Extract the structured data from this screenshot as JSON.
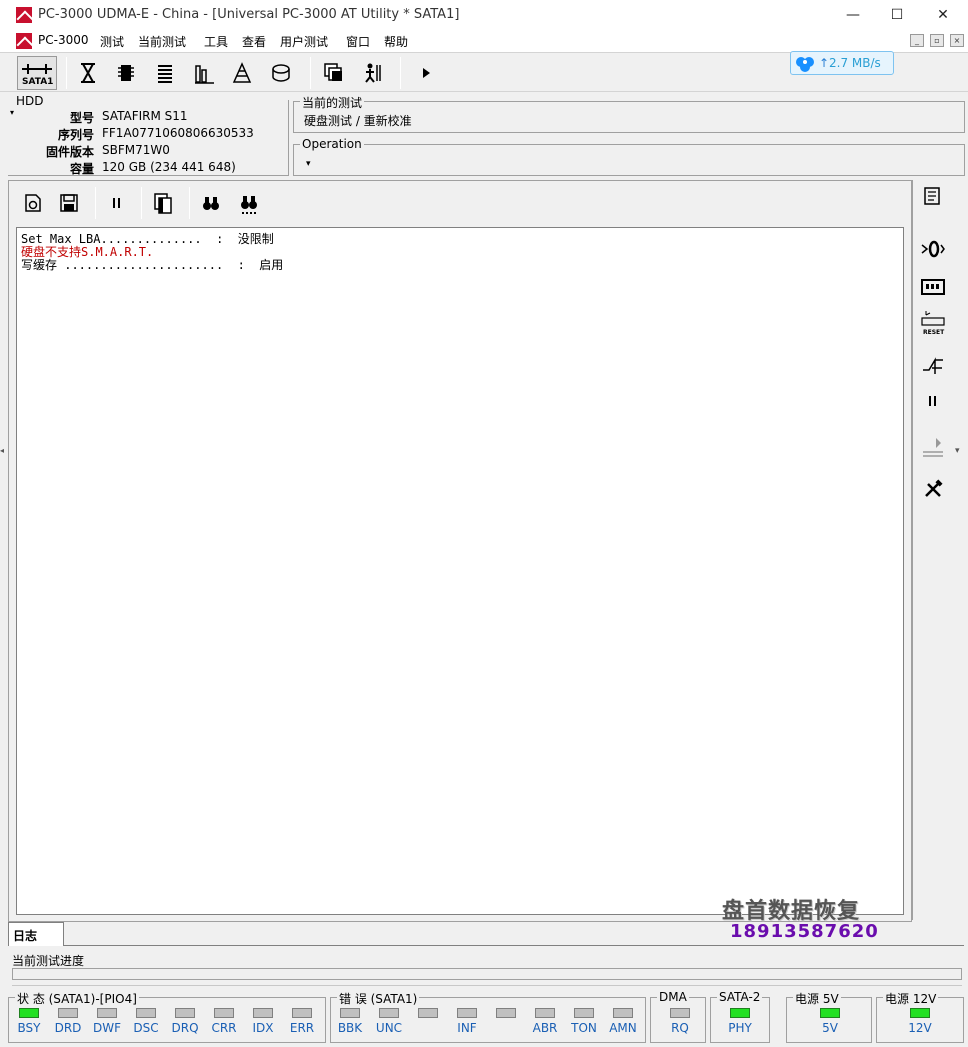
{
  "window": {
    "title": "PC-3000 UDMA-E - China - [Universal PC-3000 AT Utility * SATA1]",
    "minimize": "—",
    "maximize": "☐",
    "close": "✕"
  },
  "menu": {
    "items": [
      "PC-3000",
      "测试",
      "当前测试",
      "工具",
      "查看",
      "用户测试",
      "窗口",
      "帮助"
    ]
  },
  "toolbar": {
    "sata_label": "SATA1",
    "speed": "2.7 MB/s"
  },
  "hdd": {
    "legend": "HDD",
    "rows": [
      {
        "label": "型号",
        "value": "SATAFIRM   S11"
      },
      {
        "label": "序列号",
        "value": "FF1A0771060806630533"
      },
      {
        "label": "固件版本",
        "value": "SBFM71W0"
      },
      {
        "label": "容量",
        "value": "120 GB (234 441 648)"
      }
    ]
  },
  "current_test": {
    "legend": "当前的测试",
    "value": "硬盘测试 / 重新校准"
  },
  "operation": {
    "legend": "Operation",
    "dropdown": "▾"
  },
  "log": {
    "lines": [
      {
        "text": "Set Max LBA..............  :  没限制",
        "color": "#000000"
      },
      {
        "text": "硬盘不支持S.M.A.R.T.",
        "color": "#c00000"
      },
      {
        "text": "写缓存 ......................  :  启用",
        "color": "#000000"
      }
    ]
  },
  "tabs": {
    "log_tab": "日志"
  },
  "progress": {
    "label": "当前测试进度"
  },
  "watermark": {
    "company": "盘首数据恢复",
    "phone": "18913587620"
  },
  "status": {
    "state": {
      "legend": "状 态 (SATA1)-[PIO4]",
      "leds": [
        {
          "label": "BSY",
          "on": true
        },
        {
          "label": "DRD",
          "on": false
        },
        {
          "label": "DWF",
          "on": false
        },
        {
          "label": "DSC",
          "on": false
        },
        {
          "label": "DRQ",
          "on": false
        },
        {
          "label": "CRR",
          "on": false
        },
        {
          "label": "IDX",
          "on": false
        },
        {
          "label": "ERR",
          "on": false
        }
      ]
    },
    "error": {
      "legend": "错 误 (SATA1)",
      "leds": [
        {
          "label": "BBK",
          "on": false
        },
        {
          "label": "UNC",
          "on": false
        },
        {
          "label": "",
          "on": false
        },
        {
          "label": "INF",
          "on": false
        },
        {
          "label": "",
          "on": false
        },
        {
          "label": "ABR",
          "on": false
        },
        {
          "label": "TON",
          "on": false
        },
        {
          "label": "AMN",
          "on": false
        }
      ]
    },
    "dma": {
      "legend": "DMA",
      "label": "RQ",
      "on": false
    },
    "sata2": {
      "legend": "SATA-2",
      "label": "PHY",
      "on": true
    },
    "power5": {
      "legend": "电源 5V",
      "label": "5V",
      "on": true
    },
    "power12": {
      "legend": "电源 12V",
      "label": "12V",
      "on": true
    }
  },
  "colors": {
    "led_on": "#22e022",
    "led_off": "#c0c0c0",
    "label_blue": "#1a5fb4",
    "error_red": "#c00000"
  }
}
